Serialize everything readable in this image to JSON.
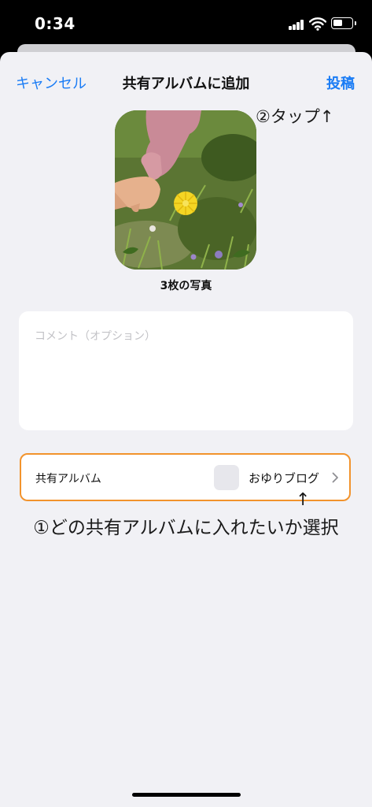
{
  "status_bar": {
    "time": "0:34",
    "icons": [
      "signal-icon",
      "wifi-icon",
      "battery-icon"
    ]
  },
  "nav": {
    "cancel_label": "キャンセル",
    "title": "共有アルバムに追加",
    "post_label": "投稿"
  },
  "annotations": {
    "tap": "②タップ↑",
    "arrow": "↑",
    "select": "①どの共有アルバムに入れたいか選択"
  },
  "photo": {
    "count_label": "3枚の写真"
  },
  "comment": {
    "placeholder": "コメント（オプション）"
  },
  "album": {
    "label": "共有アルバム",
    "value": "おゆりブログ"
  },
  "colors": {
    "accent": "#1a7cf5",
    "highlight_border": "#f2932c",
    "background": "#f1f1f5"
  }
}
